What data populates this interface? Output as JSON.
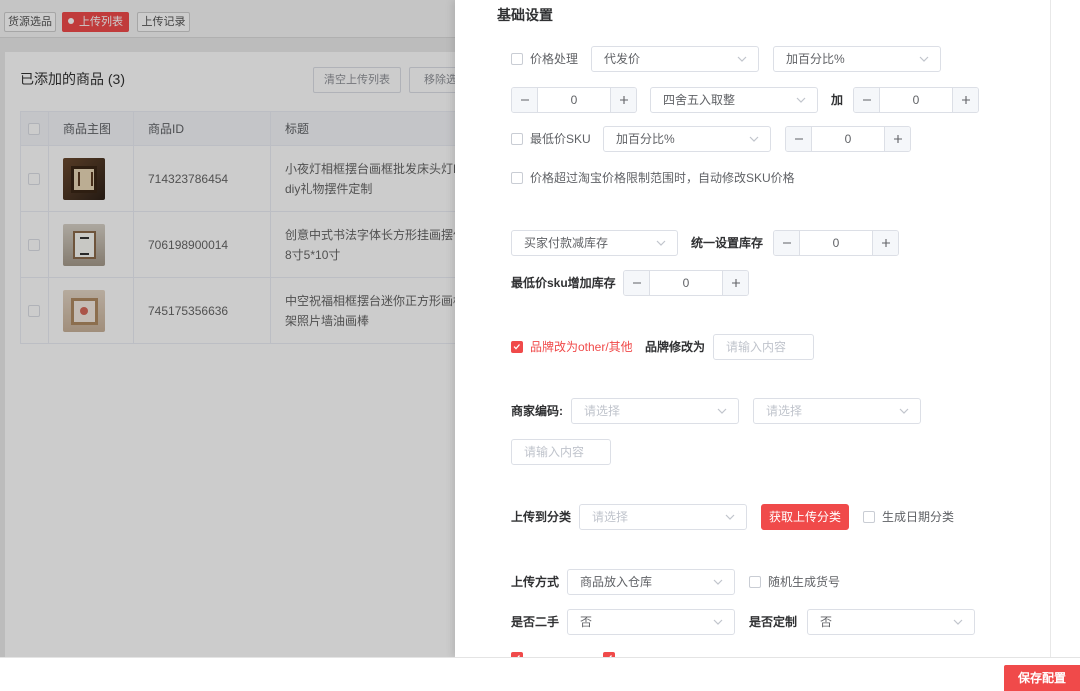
{
  "colors": {
    "accent": "#f04a4a",
    "label": "#303133",
    "text": "#606266",
    "placeholder": "#c0c4cc",
    "border": "#dcdfe6"
  },
  "background": {
    "tabs": [
      {
        "label": "货源选品",
        "active": false
      },
      {
        "label": "上传列表",
        "active": true
      },
      {
        "label": "上传记录",
        "active": false
      }
    ],
    "panel_title": "已添加的商品 (3)",
    "buttons": {
      "clear": "清空上传列表",
      "remove": "移除选"
    },
    "table": {
      "headers": [
        "商品主图",
        "商品ID",
        "标题"
      ],
      "rows": [
        {
          "id": "714323786454",
          "title_lines": [
            "小夜灯相框摆台画框批发床头灯L",
            "diy礼物摆件定制"
          ]
        },
        {
          "id": "706198900014",
          "title_lines": [
            "创意中式书法字体长方形挂画摆件",
            "8寸5*10寸"
          ]
        },
        {
          "id": "745175356636",
          "title_lines": [
            "中空祝福相框摆台迷你正方形画框",
            "架照片墙油画棒"
          ]
        }
      ]
    }
  },
  "drawer": {
    "section_title": "基础设置",
    "price_processing": {
      "label": "价格处理",
      "checked": false,
      "source": "代发价",
      "mode": "加百分比%",
      "step_value": "0",
      "rounding": "四舍五入取整",
      "add_label": "加",
      "add_value": "0"
    },
    "lowest_sku": {
      "label": "最低价SKU",
      "checked": false,
      "mode": "加百分比%",
      "value": "0"
    },
    "auto_fix": {
      "label": "价格超过淘宝价格限制范围时，自动修改SKU价格",
      "checked": false
    },
    "stock": {
      "mode": "买家付款减库存",
      "unified_label": "统一设置库存",
      "unified_value": "0",
      "lowest_label": "最低价sku增加库存",
      "lowest_value": "0"
    },
    "brand": {
      "label": "品牌改为other/其他",
      "checked": true,
      "modify_label": "品牌修改为",
      "placeholder": "请输入内容"
    },
    "merchant_code": {
      "label": "商家编码:",
      "select1_placeholder": "请选择",
      "select2_placeholder": "请选择",
      "input_placeholder": "请输入内容"
    },
    "category": {
      "label": "上传到分类",
      "placeholder": "请选择",
      "fetch_button": "获取上传分类",
      "date_label": "生成日期分类",
      "date_checked": false
    },
    "upload": {
      "label": "上传方式",
      "mode": "商品放入仓库",
      "random_label": "随机生成货号",
      "random_checked": false
    },
    "second_hand": {
      "label": "是否二手",
      "value": "否"
    },
    "custom": {
      "label": "是否定制",
      "value": "否"
    },
    "partial_checkboxes": [
      true,
      true
    ]
  },
  "footer": {
    "save": "保存配置"
  }
}
